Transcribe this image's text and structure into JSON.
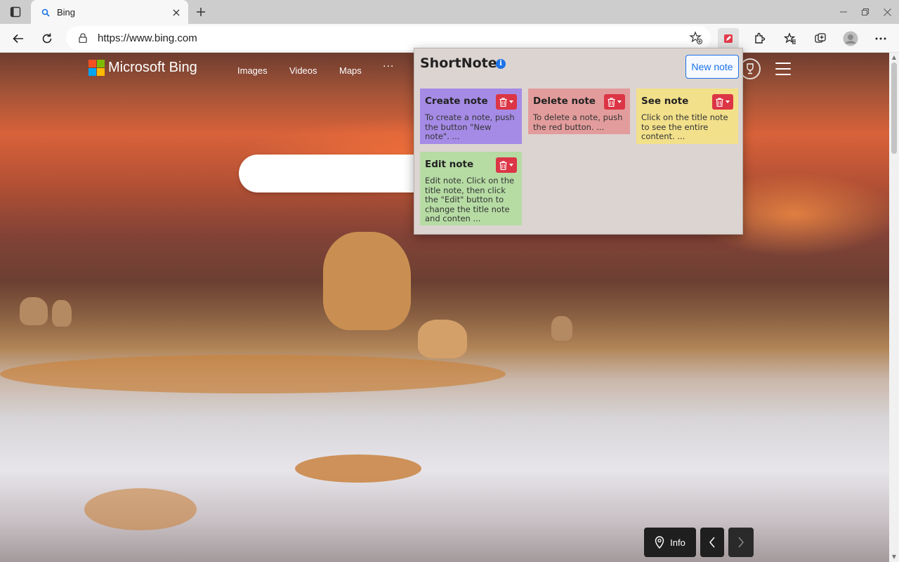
{
  "browser": {
    "tab": {
      "title": "Bing"
    },
    "url": "https://www.bing.com"
  },
  "colors": {
    "accent": "#1a73e8",
    "delete_button": "#dc3545",
    "popup_bg": "#dcd4d1"
  },
  "bing": {
    "logo_text": "Microsoft Bing",
    "nav": [
      "Images",
      "Videos",
      "Maps"
    ],
    "more": "···",
    "info_label": "Info"
  },
  "shortnotes": {
    "title": "ShortNotes",
    "new_note_label": "New note",
    "notes": [
      {
        "title": "Create note",
        "text": "To create a note, push the button \"New note\". ...",
        "color": "#a58be6"
      },
      {
        "title": "Delete note",
        "text": "To delete a note, push the red button. ...",
        "color": "#e39c9c"
      },
      {
        "title": "See note",
        "text": "Click on the title note to see the entire content. ...",
        "color": "#f2e08a"
      },
      {
        "title": "Edit note",
        "text": "Edit note. Click on the title note, then click the \"Edit\" button to change the title note and conten ...",
        "color": "#b6dca4"
      }
    ]
  }
}
